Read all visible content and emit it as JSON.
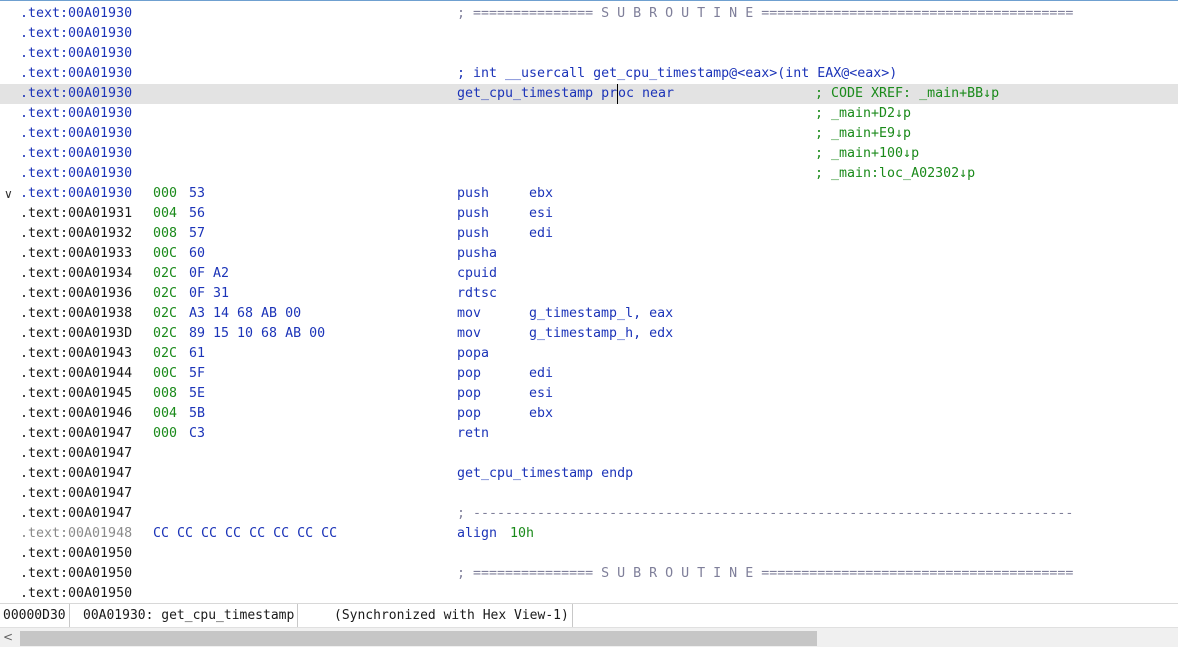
{
  "listing": {
    "rows": [
      {
        "addr": ".text:00A01930",
        "addr_color": "blue",
        "instr": "; =============== S U B R O U T I N E =======================================",
        "instr_style": "sep"
      },
      {
        "addr": ".text:00A01930",
        "addr_color": "blue"
      },
      {
        "addr": ".text:00A01930",
        "addr_color": "blue"
      },
      {
        "addr": ".text:00A01930",
        "addr_color": "blue",
        "instr": "; int __usercall get_cpu_timestamp@<eax>(int EAX@<eax>)",
        "instr_style": "blue"
      },
      {
        "addr": ".text:00A01930",
        "addr_color": "blue",
        "highlight": true,
        "instr_pre": "get_cpu_timestamp pr",
        "instr_post": "oc near",
        "instr_style": "blue",
        "comment": "; CODE XREF: _main+BB↓p"
      },
      {
        "addr": ".text:00A01930",
        "addr_color": "blue",
        "comment": "; _main+D2↓p"
      },
      {
        "addr": ".text:00A01930",
        "addr_color": "blue",
        "comment": "; _main+E9↓p"
      },
      {
        "addr": ".text:00A01930",
        "addr_color": "blue",
        "comment": "; _main+100↓p"
      },
      {
        "addr": ".text:00A01930",
        "addr_color": "blue",
        "comment": "; _main:loc_A02302↓p"
      },
      {
        "addr": ".text:00A01930",
        "addr_color": "blue",
        "fold": "∨",
        "sp": "000",
        "bytes": "53",
        "mnemonic": "push",
        "operands": "ebx"
      },
      {
        "addr": ".text:00A01931",
        "addr_color": "dark",
        "sp": "004",
        "bytes": "56",
        "mnemonic": "push",
        "operands": "esi"
      },
      {
        "addr": ".text:00A01932",
        "addr_color": "dark",
        "sp": "008",
        "bytes": "57",
        "mnemonic": "push",
        "operands": "edi"
      },
      {
        "addr": ".text:00A01933",
        "addr_color": "dark",
        "sp": "00C",
        "bytes": "60",
        "mnemonic": "pusha"
      },
      {
        "addr": ".text:00A01934",
        "addr_color": "dark",
        "sp": "02C",
        "bytes": "0F A2",
        "mnemonic": "cpuid"
      },
      {
        "addr": ".text:00A01936",
        "addr_color": "dark",
        "sp": "02C",
        "bytes": "0F 31",
        "mnemonic": "rdtsc"
      },
      {
        "addr": ".text:00A01938",
        "addr_color": "dark",
        "sp": "02C",
        "bytes": "A3 14 68 AB 00",
        "mnemonic": "mov",
        "operands": "g_timestamp_l, eax"
      },
      {
        "addr": ".text:00A0193D",
        "addr_color": "dark",
        "sp": "02C",
        "bytes": "89 15 10 68 AB 00",
        "mnemonic": "mov",
        "operands": "g_timestamp_h, edx"
      },
      {
        "addr": ".text:00A01943",
        "addr_color": "dark",
        "sp": "02C",
        "bytes": "61",
        "mnemonic": "popa"
      },
      {
        "addr": ".text:00A01944",
        "addr_color": "dark",
        "sp": "00C",
        "bytes": "5F",
        "mnemonic": "pop",
        "operands": "edi"
      },
      {
        "addr": ".text:00A01945",
        "addr_color": "dark",
        "sp": "008",
        "bytes": "5E",
        "mnemonic": "pop",
        "operands": "esi"
      },
      {
        "addr": ".text:00A01946",
        "addr_color": "dark",
        "sp": "004",
        "bytes": "5B",
        "mnemonic": "pop",
        "operands": "ebx"
      },
      {
        "addr": ".text:00A01947",
        "addr_color": "dark",
        "sp": "000",
        "bytes": "C3",
        "mnemonic": "retn"
      },
      {
        "addr": ".text:00A01947",
        "addr_color": "dark"
      },
      {
        "addr": ".text:00A01947",
        "addr_color": "dark",
        "instr": "get_cpu_timestamp endp",
        "instr_style": "blue"
      },
      {
        "addr": ".text:00A01947",
        "addr_color": "dark"
      },
      {
        "addr": ".text:00A01947",
        "addr_color": "dark",
        "instr": "; ---------------------------------------------------------------------------",
        "instr_style": "sep"
      },
      {
        "addr": ".text:00A01948",
        "addr_color": "gray",
        "bytes_plain": "CC CC CC CC CC CC CC CC",
        "mnemonic": "align",
        "operands": "10h",
        "operands_color": "green"
      },
      {
        "addr": ".text:00A01950",
        "addr_color": "dark"
      },
      {
        "addr": ".text:00A01950",
        "addr_color": "dark",
        "instr": "; =============== S U B R O U T I N E =======================================",
        "instr_style": "sep"
      },
      {
        "addr": ".text:00A01950",
        "addr_color": "dark"
      }
    ]
  },
  "status": {
    "offset": "00000D30",
    "location": "00A01930: get_cpu_timestamp",
    "sync": "(Synchronized with Hex View-1)"
  },
  "scrollbar": {
    "left_arrow": "<"
  }
}
